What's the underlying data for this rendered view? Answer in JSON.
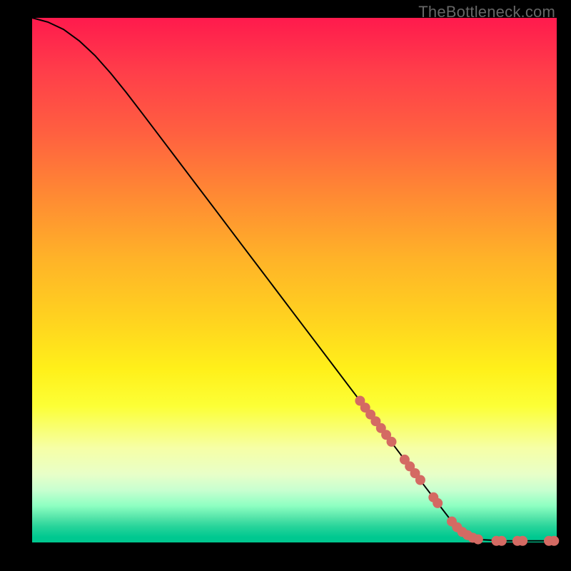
{
  "watermark": "TheBottleneck.com",
  "colors": {
    "dot": "#d46a63",
    "curve": "#000000",
    "frame": "#000000"
  },
  "chart_data": {
    "type": "line",
    "title": "",
    "xlabel": "",
    "ylabel": "",
    "xlim": [
      0,
      100
    ],
    "ylim": [
      0,
      100
    ],
    "curve": [
      {
        "x": 0,
        "y": 100.0
      },
      {
        "x": 3,
        "y": 99.2
      },
      {
        "x": 6,
        "y": 97.8
      },
      {
        "x": 9,
        "y": 95.6
      },
      {
        "x": 12,
        "y": 92.8
      },
      {
        "x": 15,
        "y": 89.4
      },
      {
        "x": 18,
        "y": 85.7
      },
      {
        "x": 21,
        "y": 81.8
      },
      {
        "x": 25,
        "y": 76.5
      },
      {
        "x": 30,
        "y": 69.9
      },
      {
        "x": 35,
        "y": 63.3
      },
      {
        "x": 40,
        "y": 56.7
      },
      {
        "x": 45,
        "y": 50.1
      },
      {
        "x": 50,
        "y": 43.5
      },
      {
        "x": 55,
        "y": 36.9
      },
      {
        "x": 60,
        "y": 30.3
      },
      {
        "x": 65,
        "y": 23.7
      },
      {
        "x": 70,
        "y": 17.1
      },
      {
        "x": 75,
        "y": 10.5
      },
      {
        "x": 80,
        "y": 4.0
      },
      {
        "x": 83,
        "y": 1.5
      },
      {
        "x": 86,
        "y": 0.5
      },
      {
        "x": 90,
        "y": 0.3
      },
      {
        "x": 95,
        "y": 0.3
      },
      {
        "x": 100,
        "y": 0.3
      }
    ],
    "markers_thick": [
      {
        "x": 62.5,
        "y": 27.0,
        "r": 7
      },
      {
        "x": 63.5,
        "y": 25.7,
        "r": 7
      },
      {
        "x": 64.5,
        "y": 24.4,
        "r": 7
      },
      {
        "x": 65.5,
        "y": 23.1,
        "r": 7
      },
      {
        "x": 66.5,
        "y": 21.8,
        "r": 7
      },
      {
        "x": 67.5,
        "y": 20.5,
        "r": 7
      },
      {
        "x": 68.5,
        "y": 19.2,
        "r": 7
      },
      {
        "x": 71.0,
        "y": 15.8,
        "r": 7
      },
      {
        "x": 72.0,
        "y": 14.5,
        "r": 7
      },
      {
        "x": 73.0,
        "y": 13.2,
        "r": 7
      },
      {
        "x": 74.0,
        "y": 11.9,
        "r": 7
      },
      {
        "x": 76.5,
        "y": 8.6,
        "r": 7
      },
      {
        "x": 77.3,
        "y": 7.5,
        "r": 7
      },
      {
        "x": 80.0,
        "y": 4.0,
        "r": 7
      },
      {
        "x": 81.0,
        "y": 2.9,
        "r": 7
      },
      {
        "x": 82.0,
        "y": 2.0,
        "r": 7
      },
      {
        "x": 83.0,
        "y": 1.4,
        "r": 7
      },
      {
        "x": 84.0,
        "y": 0.9,
        "r": 7
      },
      {
        "x": 85.0,
        "y": 0.6,
        "r": 7
      },
      {
        "x": 88.5,
        "y": 0.3,
        "r": 7
      },
      {
        "x": 89.5,
        "y": 0.3,
        "r": 7
      },
      {
        "x": 92.5,
        "y": 0.3,
        "r": 7
      },
      {
        "x": 93.5,
        "y": 0.3,
        "r": 7
      },
      {
        "x": 98.5,
        "y": 0.3,
        "r": 7
      },
      {
        "x": 99.5,
        "y": 0.3,
        "r": 7
      }
    ]
  }
}
